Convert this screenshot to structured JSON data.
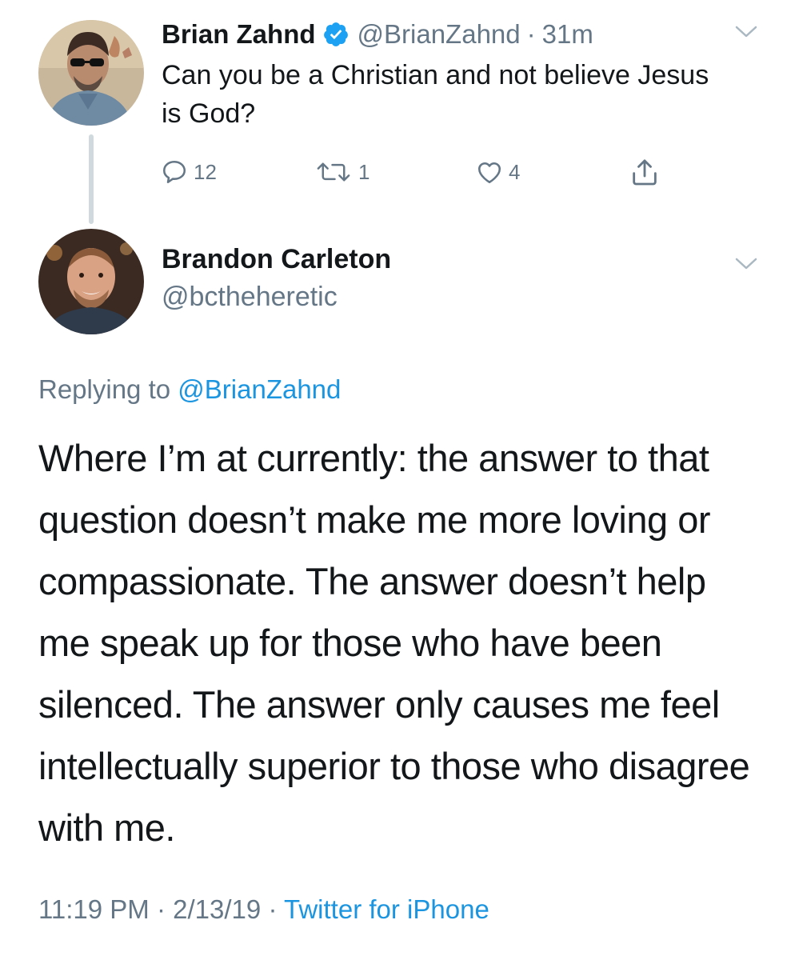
{
  "colors": {
    "text_primary": "#14171a",
    "text_secondary": "#657786",
    "link": "#1b95e0",
    "verified": "#1da1f2",
    "thread_line": "#cfd9de"
  },
  "parent_tweet": {
    "author_name": "Brian Zahnd",
    "verified_icon": "verified-badge-icon",
    "handle": "@BrianZahnd",
    "separator": "·",
    "time": "31m",
    "text": "Can you be a Christian and not believe Jesus is God?",
    "actions": {
      "reply_icon": "reply-bubble-icon",
      "reply_count": "12",
      "retweet_icon": "retweet-icon",
      "retweet_count": "1",
      "like_icon": "heart-icon",
      "like_count": "4",
      "share_icon": "share-upload-icon"
    },
    "menu_icon": "chevron-down-icon"
  },
  "reply_tweet": {
    "author_name": "Brandon Carleton",
    "handle": "@bctheheretic",
    "menu_icon": "chevron-down-icon",
    "replying_prefix": "Replying to",
    "replying_to": "@BrianZahnd",
    "text": "Where I’m at currently: the answer to that question doesn’t make me more loving or compassionate. The answer doesn’t help me speak up for those who have been silenced. The answer only causes me feel intellectually superior to those who disagree with me.",
    "time": "11:19 PM",
    "separator_1": "·",
    "date": "2/13/19",
    "separator_2": "·",
    "source": "Twitter for iPhone"
  }
}
